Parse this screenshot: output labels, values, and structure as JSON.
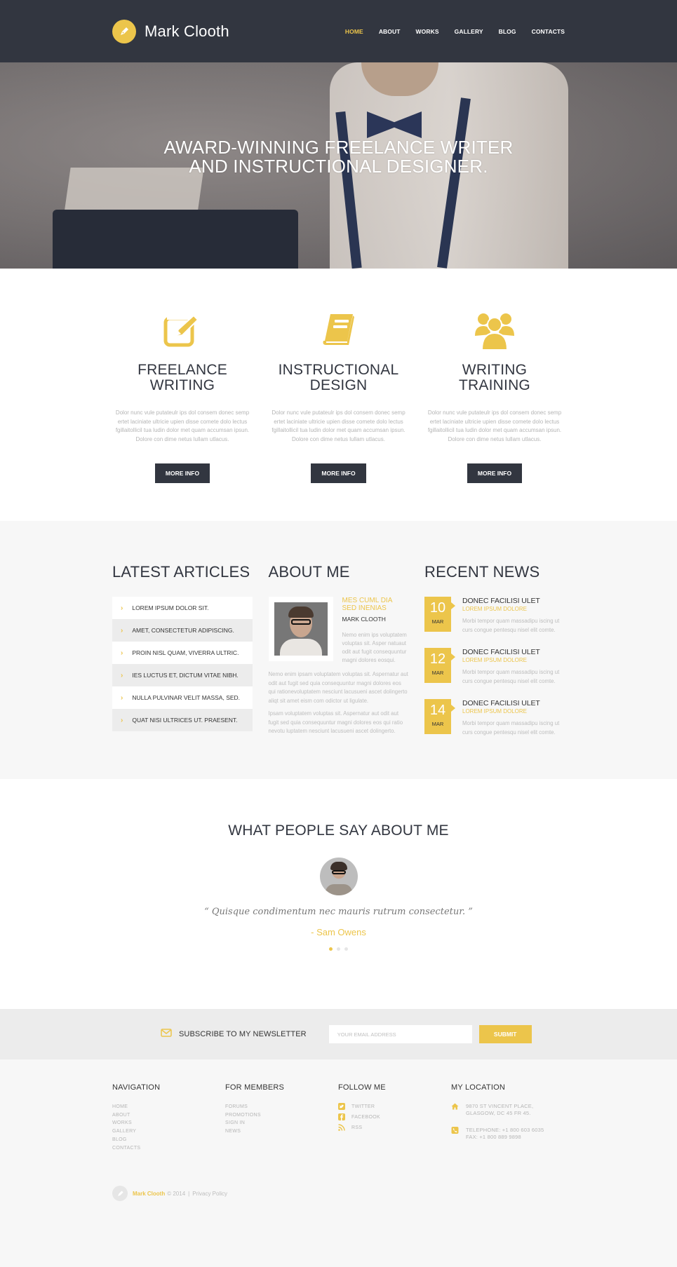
{
  "header": {
    "brand": "Mark Clooth",
    "nav": [
      {
        "label": "HOME",
        "active": true
      },
      {
        "label": "ABOUT"
      },
      {
        "label": "WORKS"
      },
      {
        "label": "GALLERY"
      },
      {
        "label": "BLOG"
      },
      {
        "label": "CONTACTS"
      }
    ]
  },
  "hero": {
    "title_line1": "AWARD-WINNING FREELANCE WRITER",
    "title_line2": "AND INSTRUCTIONAL DESIGNER."
  },
  "services": [
    {
      "icon": "edit-icon",
      "title_line1": "FREELANCE",
      "title_line2": "WRITING",
      "text": "Dolor nunc vule putateulr ips dol consem donec semp ertet laciniate ultricie upien disse comete dolo lectus fgillaitollicil tua ludin dolor met quam accumsan ipsun. Dolore con dime netus lullam utlacus.",
      "button": "MORE INFO"
    },
    {
      "icon": "book-icon",
      "title_line1": "INSTRUCTIONAL",
      "title_line2": "DESIGN",
      "text": "Dolor nunc vule putateulr ips dol consem donec semp ertet laciniate ultricie upien disse comete dolo lectus fgillaitollicil tua ludin dolor met quam accumsan ipsun. Dolore con dime netus lullam utlacus.",
      "button": "MORE INFO"
    },
    {
      "icon": "users-icon",
      "title_line1": "WRITING",
      "title_line2": "TRAINING",
      "text": "Dolor nunc vule putateulr ips dol consem donec semp ertet laciniate ultricie upien disse comete dolo lectus fgillaitollicil tua ludin dolor met quam accumsan ipsun. Dolore con dime netus lullam utlacus.",
      "button": "MORE INFO"
    }
  ],
  "latest_articles": {
    "title": "LATEST ARTICLES",
    "items": [
      "LOREM IPSUM DOLOR SIT.",
      "AMET, CONSECTETUR ADIPISCING.",
      "PROIN NISL QUAM, VIVERRA ULTRIC.",
      "IES LUCTUS ET, DICTUM VITAE NIBH.",
      "NULLA PULVINAR VELIT MASSA, SED.",
      "QUAT NISI ULTRICES UT. PRAESENT."
    ],
    "chevron": "›"
  },
  "about_me": {
    "title": "ABOUT ME",
    "headline_line1": "MES CUML DIA",
    "headline_line2": "SED INENIAS",
    "name": "MARK CLOOTH",
    "side_text": "Nemo enim ips voluptatem voluptas sit. Asper natuaut odit aut fugit consequuntur magni dolores eosqui.",
    "para1": "Nemo enim ipsam voluptatem voluptas sit. Aspernatur aut odit aut fugit sed quia consequuntur magni dolores eos qui rationevoluptatem nesciunt lacusueni ascet dolingerto aliqt sit amet eism com odictor ut ligulate.",
    "para2": "Ipsam voluptatem voluptas sit. Aspernatur aut odit aut fugit sed quia consequuntur magni dolores eos qui ratio nevotu luptatem nesciunt lacusueni ascet dolingerto."
  },
  "recent_news": {
    "title": "RECENT NEWS",
    "items": [
      {
        "day": "10",
        "month": "MAR",
        "title": "DONEC FACILISI ULET",
        "subtitle": "LOREM IPSUM DOLORE",
        "text": "Morbi tempor quam massadipu iscing ut curs congue pentesqu nisel elit comte."
      },
      {
        "day": "12",
        "month": "MAR",
        "title": "DONEC FACILISI ULET",
        "subtitle": "LOREM IPSUM DOLORE",
        "text": "Morbi tempor quam massadipu iscing ut curs congue pentesqu nisel elit comte."
      },
      {
        "day": "14",
        "month": "MAR",
        "title": "DONEC FACILISI ULET",
        "subtitle": "LOREM IPSUM DOLORE",
        "text": "Morbi tempor quam massadipu iscing ut curs congue pentesqu nisel elit comte."
      }
    ]
  },
  "testimonials": {
    "title": "WHAT PEOPLE SAY ABOUT ME",
    "quote": "“ Quisque condimentum nec mauris rutrum consectetur. ”",
    "author": "- Sam Owens",
    "slides": 3,
    "active_slide": 1
  },
  "newsletter": {
    "label": "SUBSCRIBE TO MY NEWSLETTER",
    "placeholder": "YOUR EMAIL ADDRESS",
    "value": "",
    "button": "SUBMIT"
  },
  "footer": {
    "navigation": {
      "title": "NAVIGATION",
      "links": [
        "HOME",
        "ABOUT",
        "WORKS",
        "GALLERY",
        "BLOG",
        "CONTACTS"
      ]
    },
    "members": {
      "title": "FOR MEMBERS",
      "links": [
        "FORUMS",
        "PROMOTIONS",
        "SIGN IN",
        "NEWS"
      ]
    },
    "follow": {
      "title": "FOLLOW ME",
      "links": [
        {
          "icon": "twitter-icon",
          "label": "TWITTER"
        },
        {
          "icon": "facebook-icon",
          "label": "FACEBOOK"
        },
        {
          "icon": "rss-icon",
          "label": "RSS"
        }
      ]
    },
    "location": {
      "title": "MY LOCATION",
      "address_line1": "9870 ST VINCENT PLACE,",
      "address_line2": "GLASGOW, DC 45 FR 45.",
      "phone": "TELEPHONE: +1 800 603 6035",
      "fax": "FAX: +1 800 889 9898"
    },
    "copyright": {
      "brand": "Mark Clooth",
      "year_text": "© 2014",
      "separator": "|",
      "privacy": "Privacy Policy"
    }
  },
  "colors": {
    "accent": "#ecc54b",
    "dark": "#323640",
    "light_bg": "#f7f7f7",
    "muted_text": "#b5b5b5"
  }
}
